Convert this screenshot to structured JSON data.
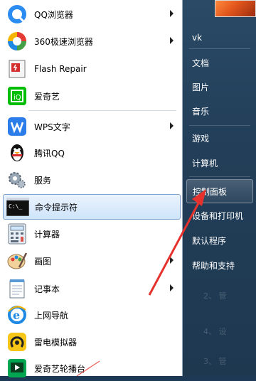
{
  "left_menu": {
    "items": [
      {
        "label": "QQ浏览器",
        "icon": "qq-browser-icon",
        "submenu": true
      },
      {
        "label": "360极速浏览器",
        "icon": "360-browser-icon",
        "submenu": true
      },
      {
        "label": "Flash Repair",
        "icon": "flash-repair-icon",
        "submenu": false
      },
      {
        "label": "爱奇艺",
        "icon": "iqiyi-icon",
        "submenu": false
      },
      {
        "label": "WPS文字",
        "icon": "wps-icon",
        "submenu": true
      },
      {
        "label": "腾讯QQ",
        "icon": "qq-penguin-icon",
        "submenu": false
      },
      {
        "label": "服务",
        "icon": "services-gear-icon",
        "submenu": false
      },
      {
        "label": "命令提示符",
        "icon": "cmd-icon",
        "submenu": false,
        "selected": true
      },
      {
        "label": "计算器",
        "icon": "calculator-icon",
        "submenu": false
      },
      {
        "label": "画图",
        "icon": "paint-icon",
        "submenu": true
      },
      {
        "label": "记事本",
        "icon": "notepad-icon",
        "submenu": true
      },
      {
        "label": "上网导航",
        "icon": "ie-icon",
        "submenu": false
      },
      {
        "label": "雷电模拟器",
        "icon": "ldplayer-icon",
        "submenu": false
      },
      {
        "label": "爱奇艺轮播台",
        "icon": "iqiyi-carousel-icon",
        "submenu": false
      }
    ]
  },
  "right_menu": {
    "items": [
      {
        "label": "vk"
      },
      {
        "label": "文档"
      },
      {
        "label": "图片"
      },
      {
        "label": "音乐"
      },
      {
        "label": "游戏"
      },
      {
        "label": "计算机"
      },
      {
        "label": "控制面板",
        "highlighted": true
      },
      {
        "label": "设备和打印机"
      },
      {
        "label": "默认程序"
      },
      {
        "label": "帮助和支持"
      }
    ]
  },
  "colors": {
    "selection_bg": "#cfe4fa",
    "annotation_arrow": "#e5322d",
    "right_panel": "#223e58"
  }
}
